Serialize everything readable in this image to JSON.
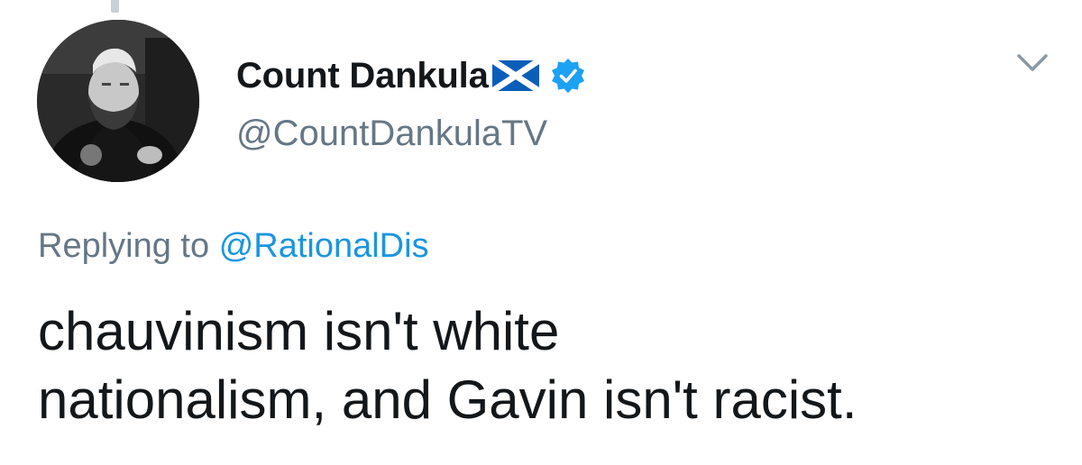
{
  "tweet": {
    "display_name": "Count Dankula",
    "handle": "@CountDankulaTV",
    "reply_prefix": "Replying to",
    "reply_mention": "@RationalDis",
    "text": "chauvinism isn't white\nnationalism, and Gavin isn't racist."
  },
  "icons": {
    "flag": "scotland-flag-icon",
    "verified": "verified-badge-icon",
    "menu": "chevron-down-icon"
  },
  "colors": {
    "text": "#14171a",
    "secondary": "#657786",
    "link": "#1b95e0",
    "verified": "#1da1f2"
  }
}
